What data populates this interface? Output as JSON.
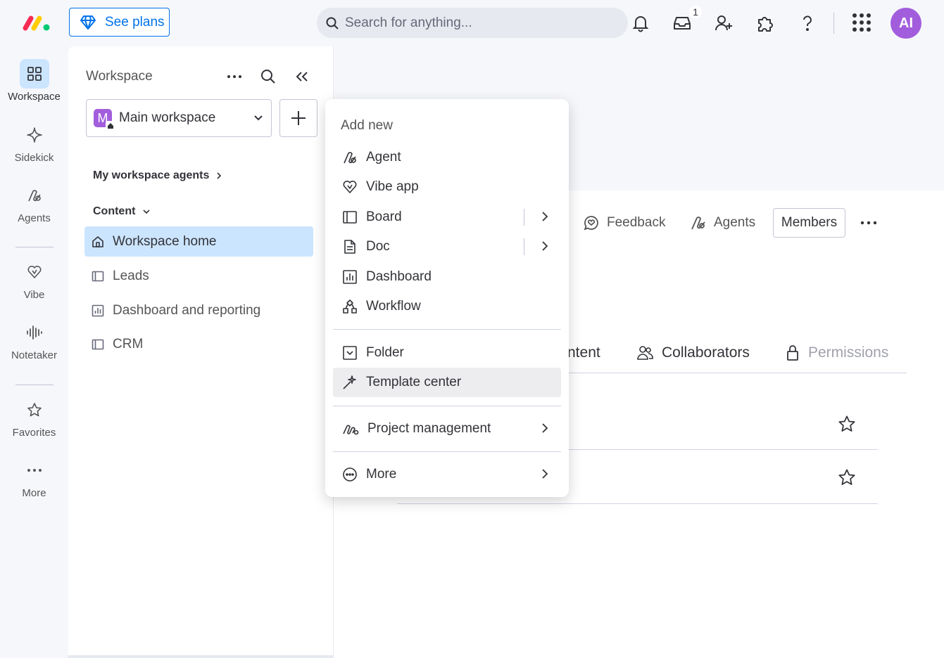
{
  "topbar": {
    "see_plans_label": "See plans",
    "search_placeholder": "Search for anything...",
    "inbox_badge": "1",
    "avatar_initials": "AI"
  },
  "rail": {
    "items": [
      {
        "label": "Workspace",
        "icon": "grid-icon"
      },
      {
        "label": "Sidekick",
        "icon": "sparkle-icon"
      },
      {
        "label": "Agents",
        "icon": "agent-icon"
      },
      {
        "label": "Vibe",
        "icon": "vibe-heart-icon"
      },
      {
        "label": "Notetaker",
        "icon": "audio-wave-icon"
      },
      {
        "label": "Favorites",
        "icon": "star-icon"
      },
      {
        "label": "More",
        "icon": "more-dots-icon"
      }
    ]
  },
  "sidebar": {
    "title": "Workspace",
    "workspace_initial": "M",
    "workspace_name": "Main workspace",
    "agents_section": "My workspace agents",
    "content_section": "Content",
    "items": [
      {
        "label": "Workspace home",
        "icon": "home-icon"
      },
      {
        "label": "Leads",
        "icon": "board-icon"
      },
      {
        "label": "Dashboard and reporting",
        "icon": "dashboard-icon"
      },
      {
        "label": "CRM",
        "icon": "board-icon"
      }
    ]
  },
  "main": {
    "feedback_label": "Feedback",
    "agents_label": "Agents",
    "members_label": "Members",
    "tabs": [
      {
        "label": "ntent"
      },
      {
        "label": "Collaborators"
      },
      {
        "label": "Permissions"
      }
    ]
  },
  "menu": {
    "title": "Add new",
    "items": [
      {
        "label": "Agent",
        "icon": "agent-icon"
      },
      {
        "label": "Vibe app",
        "icon": "vibe-heart-icon"
      },
      {
        "label": "Board",
        "icon": "board-icon"
      },
      {
        "label": "Doc",
        "icon": "doc-icon"
      },
      {
        "label": "Dashboard",
        "icon": "dashboard-icon"
      },
      {
        "label": "Workflow",
        "icon": "workflow-icon"
      },
      {
        "label": "Folder",
        "icon": "folder-icon"
      },
      {
        "label": "Template center",
        "icon": "magic-wand-icon"
      },
      {
        "label": "Project management",
        "icon": "project-icon"
      },
      {
        "label": "More",
        "icon": "more-circle-icon"
      }
    ]
  },
  "colors": {
    "accent": "#0073ea",
    "selected_bg": "#cce5ff",
    "avatar_bg": "#a25ddc",
    "logo_red": "#f62b54",
    "logo_yellow": "#ffcc00",
    "logo_green": "#00ca72"
  }
}
